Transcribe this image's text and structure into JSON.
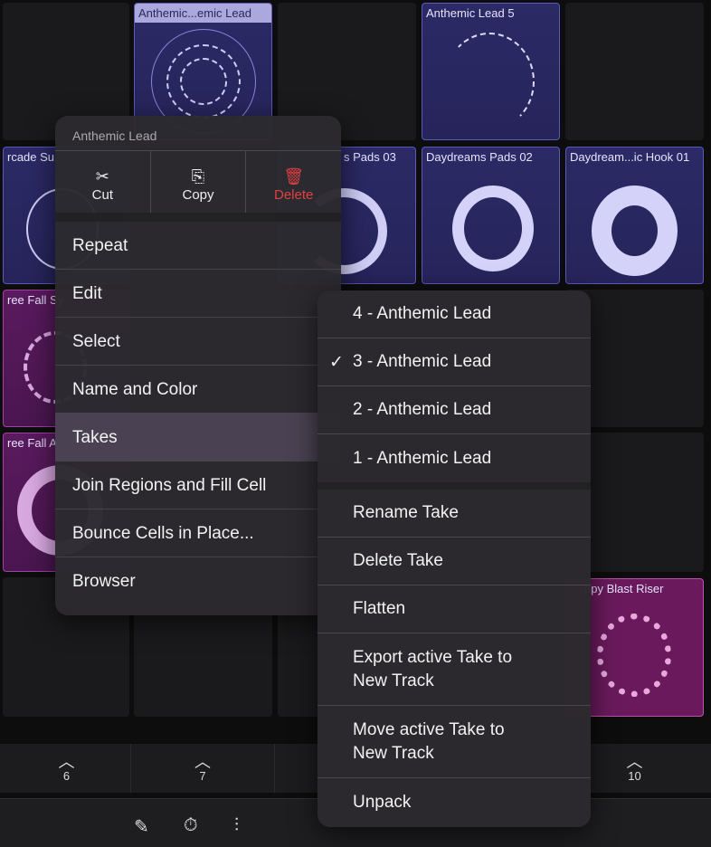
{
  "cells": [
    {
      "title": "Anthemic...emic Lead",
      "selected": true
    },
    {
      "title": "Anthemic Lead 5"
    },
    {
      "title": "rcade Su.."
    },
    {
      "title": "s Pads 03"
    },
    {
      "title": "Daydreams Pads 02"
    },
    {
      "title": "Daydream...ic Hook 01"
    },
    {
      "title": "ree Fall Sy"
    },
    {
      "title": "ree Fall A.."
    },
    {
      "title": "ppy Blast Riser"
    }
  ],
  "columns": [
    "6",
    "7",
    "10"
  ],
  "context_menu": {
    "title": "Anthemic Lead",
    "actions": [
      {
        "label": "Cut",
        "icon": "scissors-icon"
      },
      {
        "label": "Copy",
        "icon": "copy-icon"
      },
      {
        "label": "Delete",
        "icon": "trash-icon"
      }
    ],
    "items": [
      "Repeat",
      "Edit",
      "Select",
      "Name and Color",
      "Takes",
      "Join Regions and Fill Cell",
      "Bounce Cells in Place...",
      "Browser"
    ],
    "highlighted": "Takes"
  },
  "takes_menu": {
    "takes": [
      "4 - Anthemic Lead",
      "3 - Anthemic Lead",
      "2 - Anthemic Lead",
      "1 - Anthemic Lead"
    ],
    "active_take": "3 - Anthemic Lead",
    "check": "✓",
    "actions": [
      "Rename Take",
      "Delete Take",
      "Flatten",
      "Export active Take to New Track",
      "Move active Take to New Track",
      "Unpack"
    ]
  },
  "toolbar": {
    "icons": [
      "pencil-icon",
      "metronome-icon",
      "mixer-icon"
    ]
  },
  "colors": {
    "accent_delete": "#e04040",
    "region_blue": "#2c2a66",
    "region_magenta": "#6a1a5c"
  }
}
